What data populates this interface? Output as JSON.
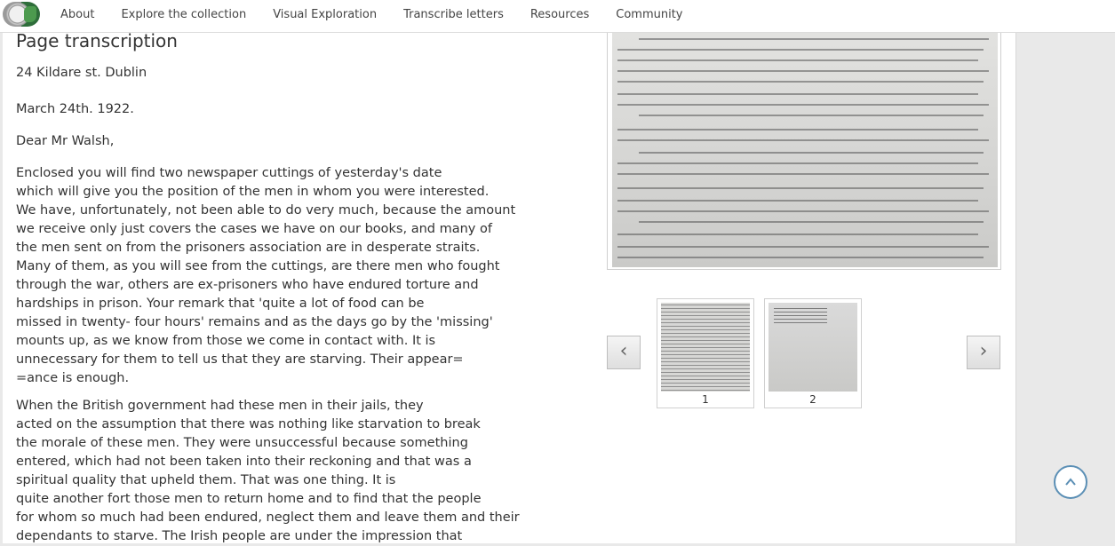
{
  "nav": {
    "items": [
      "About",
      "Explore the collection",
      "Visual Exploration",
      "Transcribe letters",
      "Resources",
      "Community"
    ]
  },
  "transcription": {
    "title": "Page transcription",
    "address": "24 Kildare st. Dublin",
    "date": "March 24th. 1922.",
    "salutation": "Dear Mr Walsh,",
    "paragraph1": [
      "Enclosed you will find two newspaper cuttings of yesterday's date",
      "which will give you the position of the men in whom you were interested.",
      "We have, unfortunately, not been able to do very much, because the amount",
      "we receive only just covers the cases we have on our books, and many of",
      "the men sent on from the prisoners association are in desperate straits.",
      "Many of them, as you will see from the cuttings, are there men who fought",
      "through the war, others are ex-prisoners who have endured torture and",
      "hardships in prison. Your remark that 'quite a lot of food can be",
      "missed in twenty- four hours' remains and as the days go by the 'missing'",
      "mounts up, as we know from those we come in contact with. It is",
      "unnecessary for them to tell us that they are starving. Their appear=",
      "=ance is enough."
    ],
    "paragraph2": [
      "When the British government had these men in their jails, they",
      "acted on the assumption that there was nothing like starvation to break",
      "the morale of these men. They were unsuccessful because something",
      "entered, which had not been taken into their reckoning and that was a",
      "spiritual quality that upheld them. That was one thing. It is",
      "quite another fort those men to return home and to find that the people",
      "for whom so much had been endured, neglect them and leave them and their",
      "dependants to starve. The Irish people are under the impression that"
    ]
  },
  "viewer": {
    "thumbnails": [
      {
        "label": "1"
      },
      {
        "label": "2"
      }
    ],
    "prev_icon": "‹",
    "next_icon": "›"
  },
  "icons": {
    "logo": "logo-seal-icon",
    "back_to_top": "chevron-up-icon"
  },
  "colors": {
    "accent": "#5b8fb5",
    "background": "#e9e9e9"
  }
}
